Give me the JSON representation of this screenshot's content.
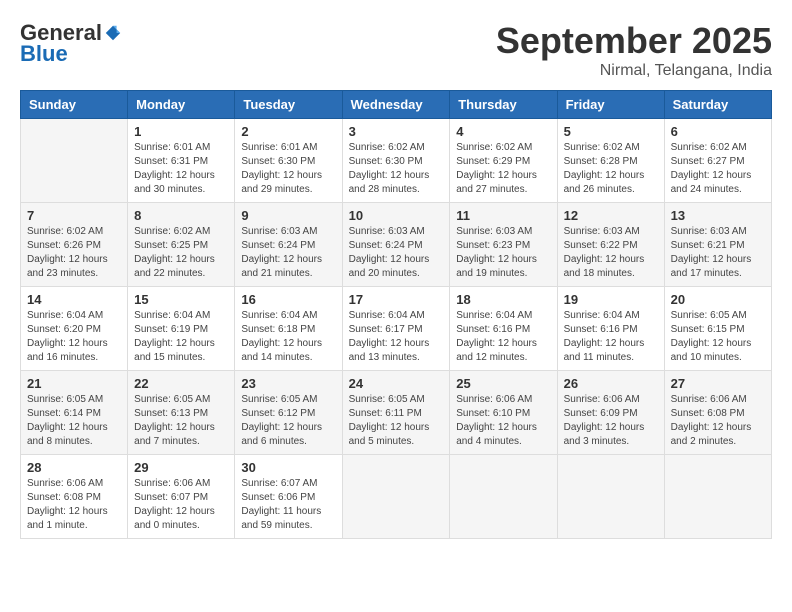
{
  "header": {
    "logo": {
      "general": "General",
      "blue": "Blue"
    },
    "title": "September 2025",
    "location": "Nirmal, Telangana, India"
  },
  "calendar": {
    "days_of_week": [
      "Sunday",
      "Monday",
      "Tuesday",
      "Wednesday",
      "Thursday",
      "Friday",
      "Saturday"
    ],
    "weeks": [
      [
        {
          "day": "",
          "info": ""
        },
        {
          "day": "1",
          "info": "Sunrise: 6:01 AM\nSunset: 6:31 PM\nDaylight: 12 hours\nand 30 minutes."
        },
        {
          "day": "2",
          "info": "Sunrise: 6:01 AM\nSunset: 6:30 PM\nDaylight: 12 hours\nand 29 minutes."
        },
        {
          "day": "3",
          "info": "Sunrise: 6:02 AM\nSunset: 6:30 PM\nDaylight: 12 hours\nand 28 minutes."
        },
        {
          "day": "4",
          "info": "Sunrise: 6:02 AM\nSunset: 6:29 PM\nDaylight: 12 hours\nand 27 minutes."
        },
        {
          "day": "5",
          "info": "Sunrise: 6:02 AM\nSunset: 6:28 PM\nDaylight: 12 hours\nand 26 minutes."
        },
        {
          "day": "6",
          "info": "Sunrise: 6:02 AM\nSunset: 6:27 PM\nDaylight: 12 hours\nand 24 minutes."
        }
      ],
      [
        {
          "day": "7",
          "info": "Sunrise: 6:02 AM\nSunset: 6:26 PM\nDaylight: 12 hours\nand 23 minutes."
        },
        {
          "day": "8",
          "info": "Sunrise: 6:02 AM\nSunset: 6:25 PM\nDaylight: 12 hours\nand 22 minutes."
        },
        {
          "day": "9",
          "info": "Sunrise: 6:03 AM\nSunset: 6:24 PM\nDaylight: 12 hours\nand 21 minutes."
        },
        {
          "day": "10",
          "info": "Sunrise: 6:03 AM\nSunset: 6:24 PM\nDaylight: 12 hours\nand 20 minutes."
        },
        {
          "day": "11",
          "info": "Sunrise: 6:03 AM\nSunset: 6:23 PM\nDaylight: 12 hours\nand 19 minutes."
        },
        {
          "day": "12",
          "info": "Sunrise: 6:03 AM\nSunset: 6:22 PM\nDaylight: 12 hours\nand 18 minutes."
        },
        {
          "day": "13",
          "info": "Sunrise: 6:03 AM\nSunset: 6:21 PM\nDaylight: 12 hours\nand 17 minutes."
        }
      ],
      [
        {
          "day": "14",
          "info": "Sunrise: 6:04 AM\nSunset: 6:20 PM\nDaylight: 12 hours\nand 16 minutes."
        },
        {
          "day": "15",
          "info": "Sunrise: 6:04 AM\nSunset: 6:19 PM\nDaylight: 12 hours\nand 15 minutes."
        },
        {
          "day": "16",
          "info": "Sunrise: 6:04 AM\nSunset: 6:18 PM\nDaylight: 12 hours\nand 14 minutes."
        },
        {
          "day": "17",
          "info": "Sunrise: 6:04 AM\nSunset: 6:17 PM\nDaylight: 12 hours\nand 13 minutes."
        },
        {
          "day": "18",
          "info": "Sunrise: 6:04 AM\nSunset: 6:16 PM\nDaylight: 12 hours\nand 12 minutes."
        },
        {
          "day": "19",
          "info": "Sunrise: 6:04 AM\nSunset: 6:16 PM\nDaylight: 12 hours\nand 11 minutes."
        },
        {
          "day": "20",
          "info": "Sunrise: 6:05 AM\nSunset: 6:15 PM\nDaylight: 12 hours\nand 10 minutes."
        }
      ],
      [
        {
          "day": "21",
          "info": "Sunrise: 6:05 AM\nSunset: 6:14 PM\nDaylight: 12 hours\nand 8 minutes."
        },
        {
          "day": "22",
          "info": "Sunrise: 6:05 AM\nSunset: 6:13 PM\nDaylight: 12 hours\nand 7 minutes."
        },
        {
          "day": "23",
          "info": "Sunrise: 6:05 AM\nSunset: 6:12 PM\nDaylight: 12 hours\nand 6 minutes."
        },
        {
          "day": "24",
          "info": "Sunrise: 6:05 AM\nSunset: 6:11 PM\nDaylight: 12 hours\nand 5 minutes."
        },
        {
          "day": "25",
          "info": "Sunrise: 6:06 AM\nSunset: 6:10 PM\nDaylight: 12 hours\nand 4 minutes."
        },
        {
          "day": "26",
          "info": "Sunrise: 6:06 AM\nSunset: 6:09 PM\nDaylight: 12 hours\nand 3 minutes."
        },
        {
          "day": "27",
          "info": "Sunrise: 6:06 AM\nSunset: 6:08 PM\nDaylight: 12 hours\nand 2 minutes."
        }
      ],
      [
        {
          "day": "28",
          "info": "Sunrise: 6:06 AM\nSunset: 6:08 PM\nDaylight: 12 hours\nand 1 minute."
        },
        {
          "day": "29",
          "info": "Sunrise: 6:06 AM\nSunset: 6:07 PM\nDaylight: 12 hours\nand 0 minutes."
        },
        {
          "day": "30",
          "info": "Sunrise: 6:07 AM\nSunset: 6:06 PM\nDaylight: 11 hours\nand 59 minutes."
        },
        {
          "day": "",
          "info": ""
        },
        {
          "day": "",
          "info": ""
        },
        {
          "day": "",
          "info": ""
        },
        {
          "day": "",
          "info": ""
        }
      ]
    ]
  }
}
